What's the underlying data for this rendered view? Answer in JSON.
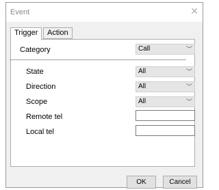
{
  "window": {
    "title": "Event",
    "close_glyph": "✕",
    "close_icon": "close-icon"
  },
  "tabs": [
    {
      "label": "Trigger",
      "active": true
    },
    {
      "label": "Action",
      "active": false
    }
  ],
  "category": {
    "label": "Category",
    "value": "Call"
  },
  "fields": {
    "state": {
      "label": "State",
      "value": "All"
    },
    "direction": {
      "label": "Direction",
      "value": "All"
    },
    "scope": {
      "label": "Scope",
      "value": "All"
    },
    "remote_tel": {
      "label": "Remote tel",
      "value": ""
    },
    "local_tel": {
      "label": "Local tel",
      "value": ""
    }
  },
  "buttons": {
    "ok": "OK",
    "cancel": "Cancel"
  }
}
